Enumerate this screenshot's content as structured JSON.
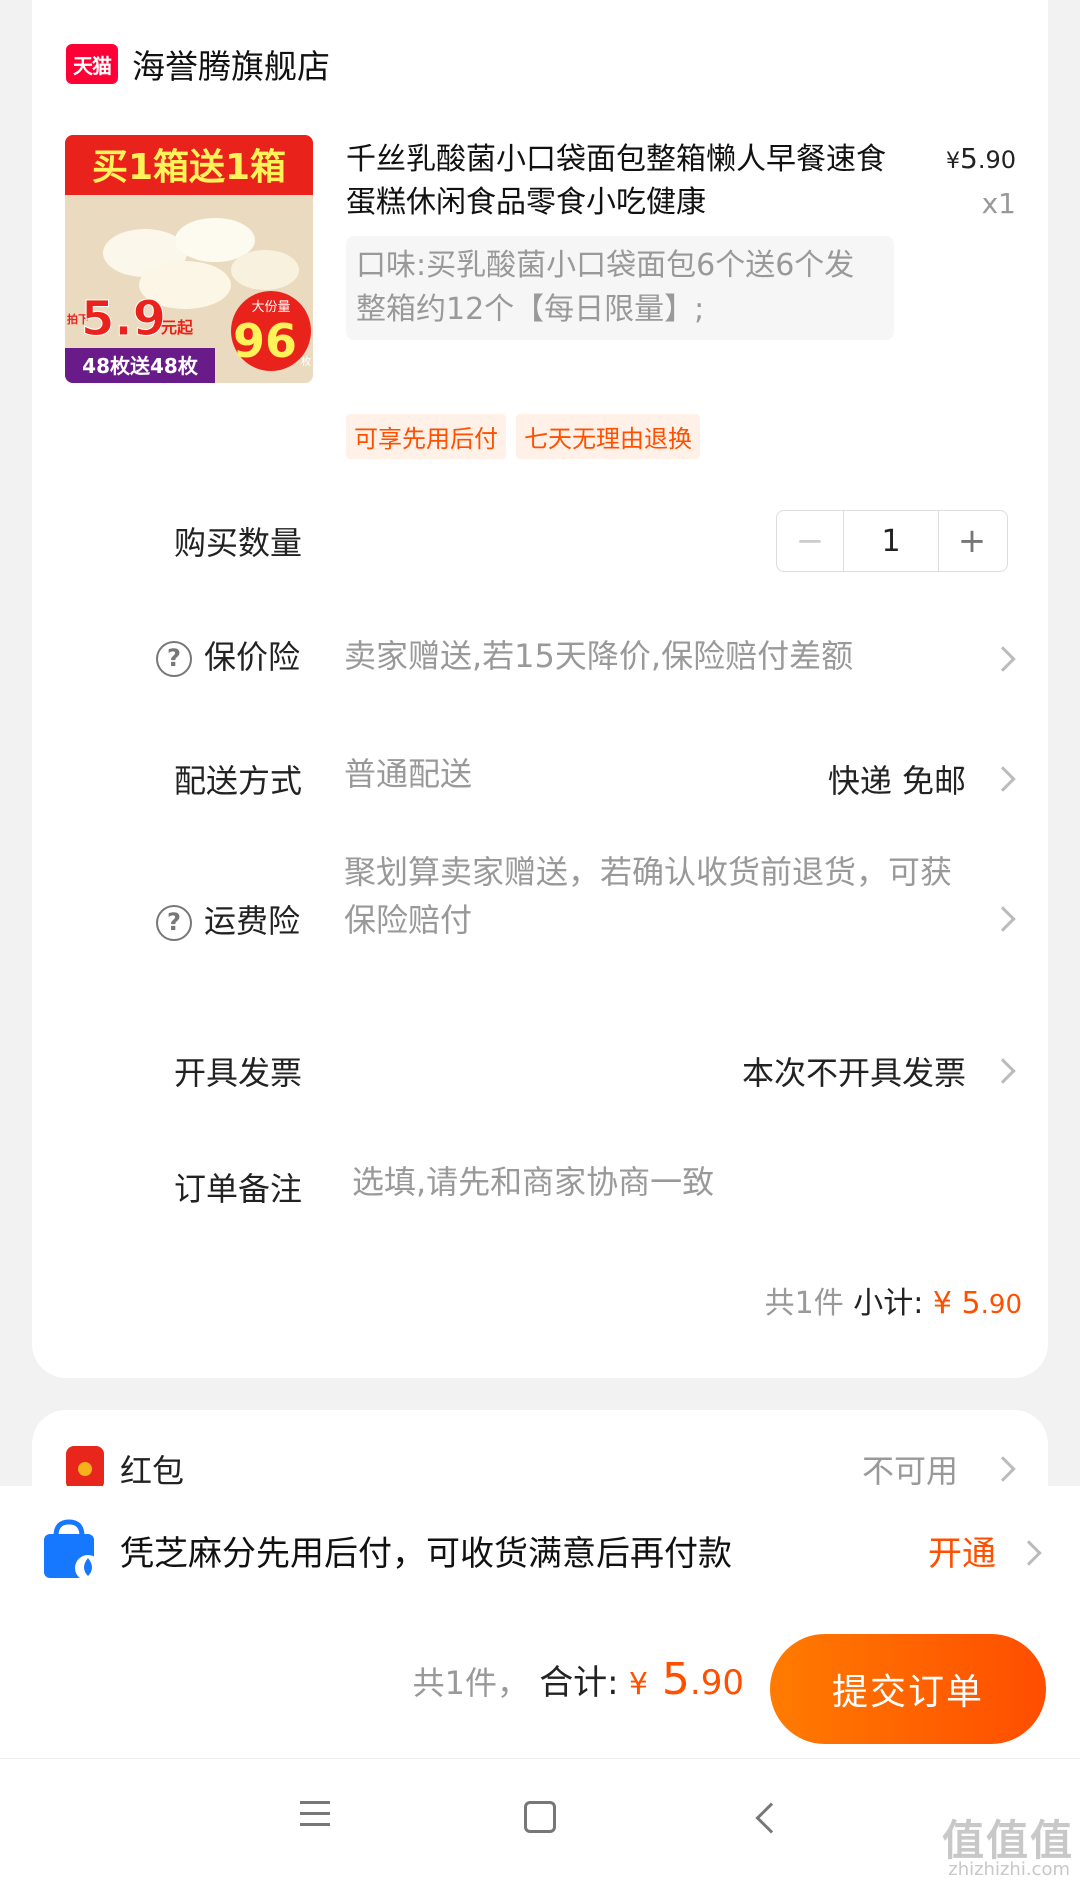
{
  "shop": {
    "logo_text": "天猫",
    "name": "海誉腾旗舰店"
  },
  "product": {
    "image_texts": {
      "banner": "买1箱送1箱",
      "price_badge": "5.9",
      "price_prefix": "拍下",
      "price_suffix": "元起",
      "big_portion": "大份量",
      "count": "96",
      "count_unit": "枚",
      "bottom": "48枚送48枚"
    },
    "title": "千丝乳酸菌小口袋面包整箱懒人早餐速食蛋糕休闲食品零食小吃健康",
    "price_yen": "¥",
    "price_int": "5",
    "price_cents": ".90",
    "quantity": "x1",
    "sku": "口味:买乳酸菌小口袋面包6个送6个发整箱约12个【每日限量】;",
    "tags": [
      "可享先用后付",
      "七天无理由退换"
    ]
  },
  "rows": {
    "quantity_label": "购买数量",
    "quantity_value": "1",
    "minus": "−",
    "plus": "+",
    "price_protect_label": "保价险",
    "price_protect_desc": "卖家赠送,若15天降价,保险赔付差额",
    "delivery_label": "配送方式",
    "delivery_desc": "普通配送",
    "delivery_value": "快递 免邮",
    "shipping_ins_label": "运费险",
    "shipping_ins_desc": "聚划算卖家赠送，若确认收货前退货，可获保险赔付",
    "invoice_label": "开具发票",
    "invoice_value": "本次不开具发票",
    "note_label": "订单备注",
    "note_placeholder": "选填,请先和商家协商一致",
    "help_symbol": "?"
  },
  "subtotal": {
    "count_text": "共1件",
    "label": "小计:",
    "yen": "¥",
    "int": "5",
    "cents": ".90"
  },
  "redpacket": {
    "label": "红包",
    "value": "不可用"
  },
  "bnpl": {
    "text": "凭芝麻分先用后付，可收货满意后再付款",
    "cta": "开通"
  },
  "checkout": {
    "count_text": "共1件，",
    "label": "合计:",
    "yen": "¥",
    "int": "5",
    "cents": ".90",
    "submit": "提交订单"
  },
  "watermark": {
    "text": "值值值",
    "url": "zhizhizhi.com"
  },
  "colors": {
    "accent": "#ff5000",
    "tmall": "#ff0036"
  }
}
